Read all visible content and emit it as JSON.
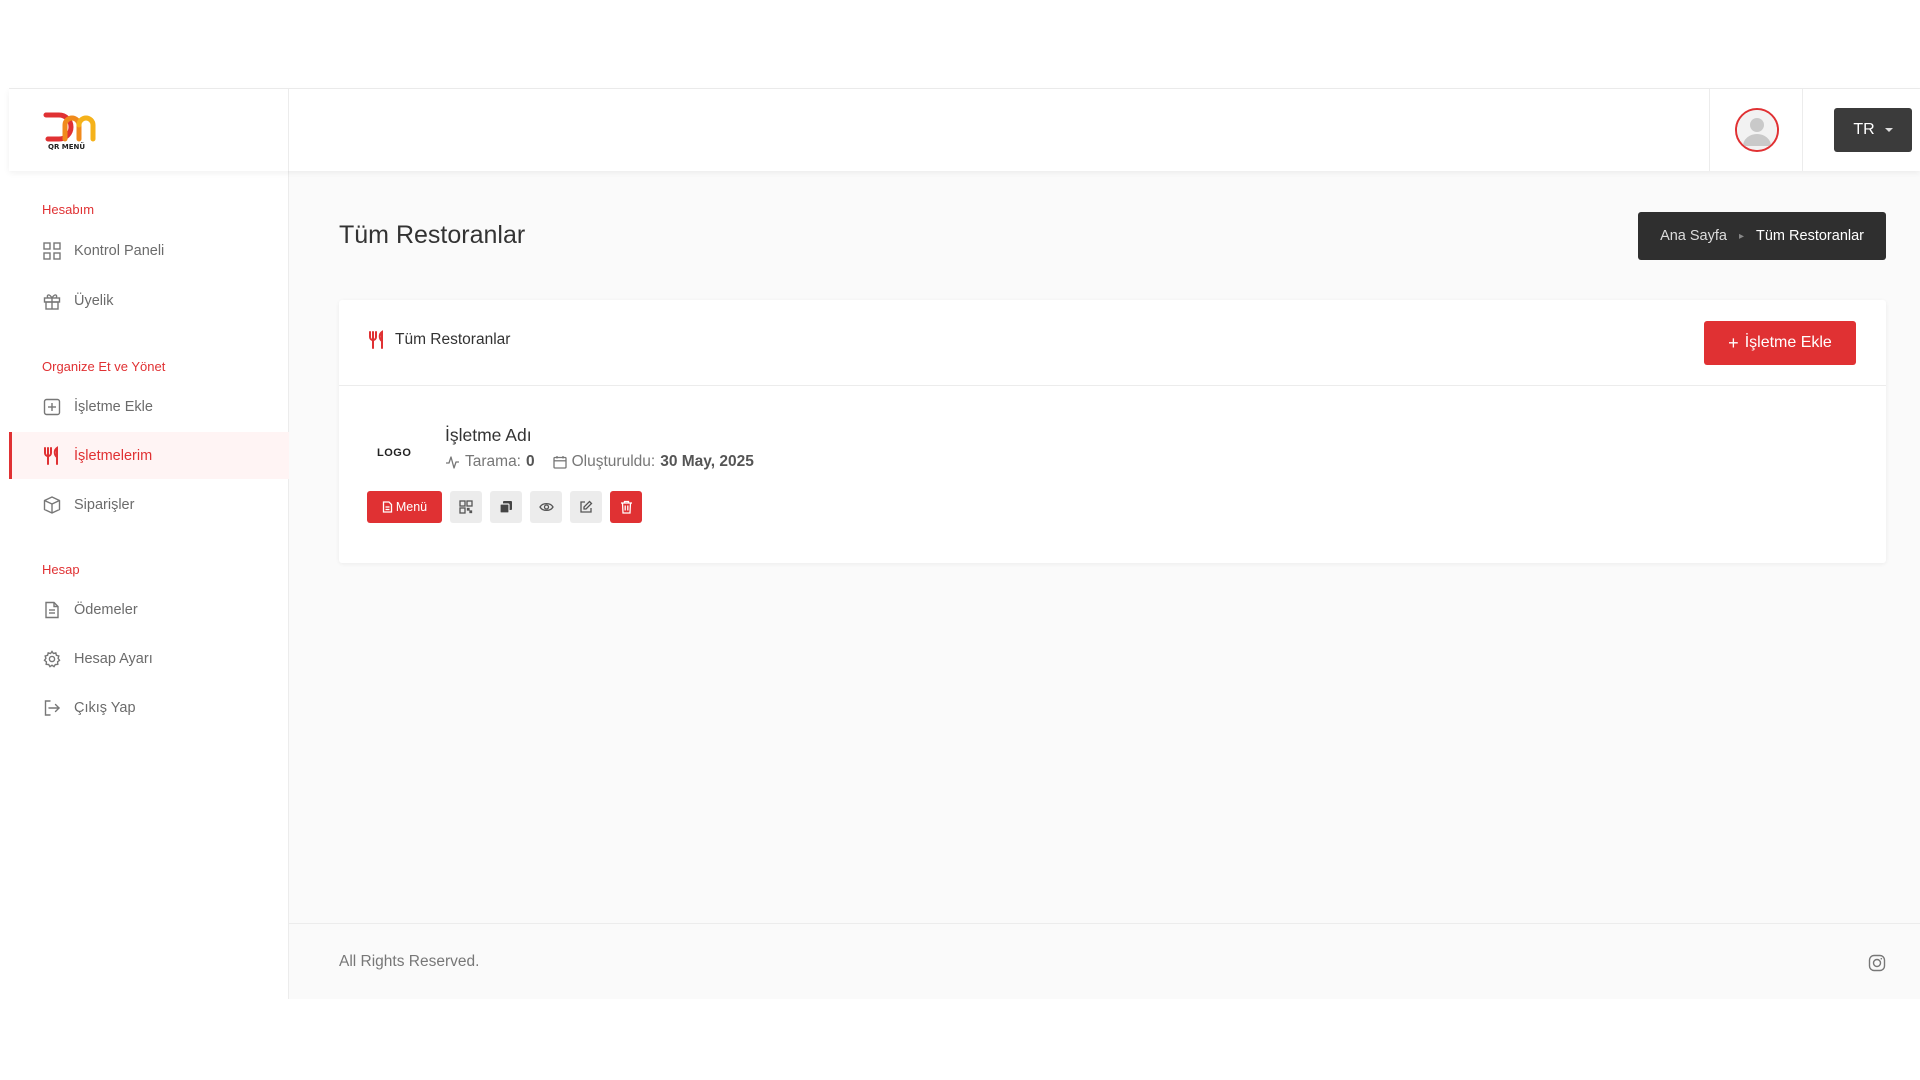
{
  "brand": {
    "logo_caption": "QR MENÜ",
    "accent": "#e03133"
  },
  "header": {
    "language": "TR"
  },
  "sidebar": {
    "sections": [
      {
        "title": "Hesabım"
      },
      {
        "title": "Organize Et ve Yönet"
      },
      {
        "title": "Hesap"
      }
    ],
    "items": [
      {
        "label": "Kontrol Paneli",
        "icon": "grid-icon"
      },
      {
        "label": "Üyelik",
        "icon": "gift-icon"
      },
      {
        "label": "İşletme Ekle",
        "icon": "plus-square-icon"
      },
      {
        "label": "İşletmelerim",
        "icon": "utensils-icon",
        "active": true
      },
      {
        "label": "Siparişler",
        "icon": "box-icon"
      },
      {
        "label": "Ödemeler",
        "icon": "document-icon"
      },
      {
        "label": "Hesap Ayarı",
        "icon": "gear-icon"
      },
      {
        "label": "Çıkış Yap",
        "icon": "logout-icon"
      }
    ]
  },
  "main": {
    "page_title": "Tüm Restoranlar",
    "breadcrumb": [
      "Ana Sayfa",
      "Tüm Restoranlar"
    ],
    "card": {
      "title": "Tüm Restoranlar",
      "add_button": "İşletme Ekle",
      "business": {
        "logo_text": "LOGO",
        "name": "İşletme Adı",
        "scan_label": "Tarama:",
        "scan_count": "0",
        "created_label": "Oluşturuldu:",
        "created_date": "30 May, 2025"
      },
      "actions": {
        "menu_label": "Menü",
        "icons": [
          "qr-code-icon",
          "copy-icon",
          "eye-icon",
          "edit-icon",
          "trash-icon"
        ]
      }
    }
  },
  "footer": {
    "text": "All Rights Reserved.",
    "social_icon": "instagram-icon"
  }
}
